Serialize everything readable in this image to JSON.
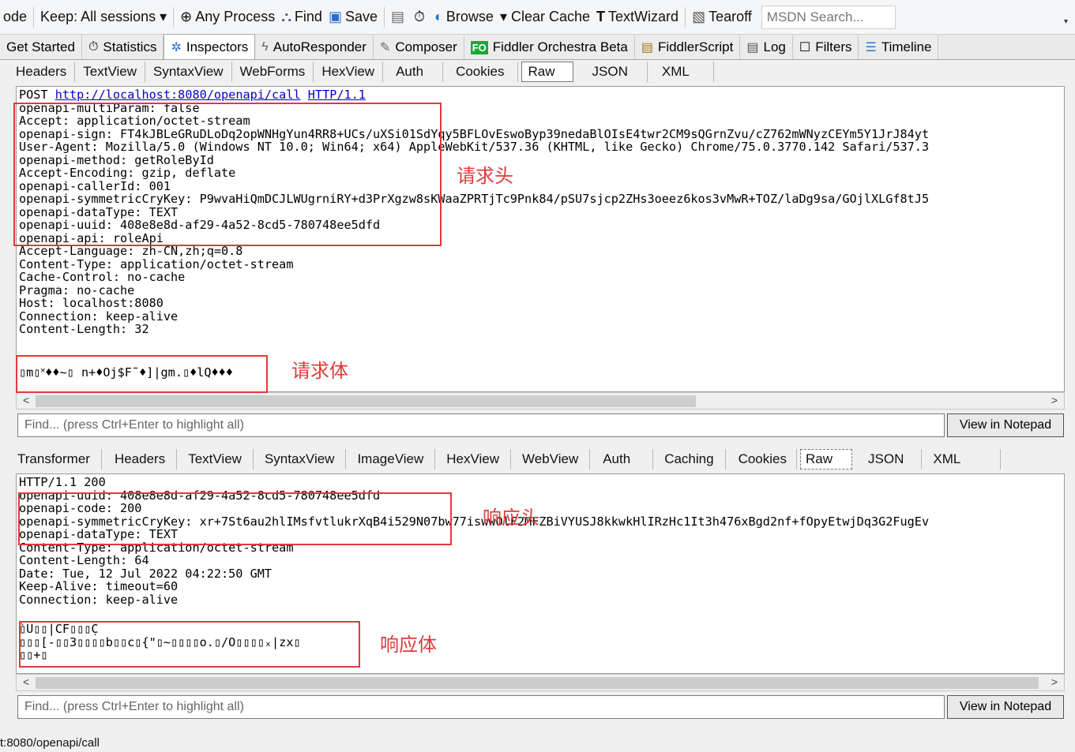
{
  "toolbar": {
    "items": [
      {
        "label": "ode",
        "icon": ""
      },
      {
        "label": "Keep: All sessions ▾",
        "icon": ""
      },
      {
        "label": "Any Process",
        "icon": "crosshair-icon"
      },
      {
        "label": "Find",
        "icon": "binoculars-icon"
      },
      {
        "label": "Save",
        "icon": "save-icon"
      },
      {
        "label": "",
        "icon": "clipboard-icon"
      },
      {
        "label": "",
        "icon": "timer-icon"
      },
      {
        "label": "Browse",
        "icon": "browser-icon"
      },
      {
        "label": "▾ Clear Cache",
        "icon": "clear-cache-icon"
      },
      {
        "label": "TextWizard",
        "icon": "text-wizard-icon"
      },
      {
        "label": "Tearoff",
        "icon": "tearoff-icon"
      }
    ],
    "search_placeholder": "MSDN Search..."
  },
  "main_tabs": [
    {
      "label": "Get Started",
      "icon": ""
    },
    {
      "label": "Statistics",
      "icon": "stopwatch-icon"
    },
    {
      "label": "Inspectors",
      "icon": "inspect-icon",
      "active": true
    },
    {
      "label": "AutoResponder",
      "icon": "lightning-icon"
    },
    {
      "label": "Composer",
      "icon": "compose-icon"
    },
    {
      "label": "Fiddler Orchestra Beta",
      "icon": "fo-icon"
    },
    {
      "label": "FiddlerScript",
      "icon": "script-icon"
    },
    {
      "label": "Log",
      "icon": "log-icon"
    },
    {
      "label": "Filters",
      "icon": "checkbox-icon"
    },
    {
      "label": "Timeline",
      "icon": "timeline-icon"
    }
  ],
  "request": {
    "tabs": [
      "Headers",
      "TextView",
      "SyntaxView",
      "WebForms",
      "HexView",
      "Auth",
      "Cookies",
      "Raw",
      "JSON",
      "XML"
    ],
    "active_tab": "Raw",
    "method": "POST",
    "url": "http://localhost:8080/openapi/call",
    "protocol": "HTTP/1.1",
    "headers": [
      "openapi-multiParam: false",
      "Accept: application/octet-stream",
      "openapi-sign: FT4kJBLeGRuDLoDq2opWNHgYun4RR8+UCs/uXSi01SdYqy5BFLOvEswoByp39nedaBlOIsE4twr2CM9sQGrnZvu/cZ762mWNyzCEYm5Y1JrJ84yt",
      "User-Agent: Mozilla/5.0 (Windows NT 10.0; Win64; x64) AppleWebKit/537.36 (KHTML, like Gecko) Chrome/75.0.3770.142 Safari/537.3",
      "openapi-method: getRoleById",
      "Accept-Encoding: gzip, deflate",
      "openapi-callerId: 001",
      "openapi-symmetricCryKey: P9wvaHiQmDCJLWUgrniRY+d3PrXgzw8sKWaaZPRTjTc9Pnk84/pSU7sjcp2ZHs3oeez6kos3vMwR+TOZ/laDg9sa/GOjlXLGf8tJ5",
      "openapi-dataType: TEXT",
      "openapi-uuid: 408e8e8d-af29-4a52-8cd5-780748ee5dfd",
      "openapi-api: roleApi",
      "Accept-Language: zh-CN,zh;q=0.8",
      "Content-Type: application/octet-stream",
      "Cache-Control: no-cache",
      "Pragma: no-cache",
      "Host: localhost:8080",
      "Connection: keep-alive",
      "Content-Length: 32"
    ],
    "body": "▯m▯˟♦♦~▯ n+♦Oj$F˜♦]|gm.▯♦lQ♦♦♦",
    "annotation_header": "请求头",
    "annotation_body": "请求体",
    "find_placeholder": "Find... (press Ctrl+Enter to highlight all)",
    "notepad_label": "View in Notepad"
  },
  "response": {
    "tabs": [
      "Transformer",
      "Headers",
      "TextView",
      "SyntaxView",
      "ImageView",
      "HexView",
      "WebView",
      "Auth",
      "Caching",
      "Cookies",
      "Raw",
      "JSON",
      "XML"
    ],
    "active_tab": "Raw",
    "status_line": "HTTP/1.1 200",
    "headers": [
      "openapi-uuid: 408e8e8d-af29-4a52-8cd5-780748ee5dfd",
      "openapi-code: 200",
      "openapi-symmetricCryKey: xr+7St6au2hlIMsfvtlukrXqB4i529N07bw77iswwOlF2MFZBiVYUSJ8kkwkHlIRzHc1It3h476xBgd2nf+fOpyEtwjDq3G2FugEv",
      "openapi-dataType: TEXT",
      "Content-Type: application/octet-stream",
      "Content-Length: 64",
      "Date: Tue, 12 Jul 2022 04:22:50 GMT",
      "Keep-Alive: timeout=60",
      "Connection: keep-alive"
    ],
    "body_lines": [
      "̀▯U▯▯|CF▯▯▯C̣",
      "▯▯▯[-▯▯3▯▯▯▯b▯▯c▯{\"▯~▯▯▯▯o.▯/O▯▯▯▯ₓ|zx▯",
      "▯▯+▯"
    ],
    "annotation_header": "响应头",
    "annotation_body": "响应体",
    "find_placeholder": "Find... (press Ctrl+Enter to highlight all)",
    "notepad_label": "View in Notepad"
  },
  "status_bar": {
    "text": "t:8080/openapi/call"
  }
}
